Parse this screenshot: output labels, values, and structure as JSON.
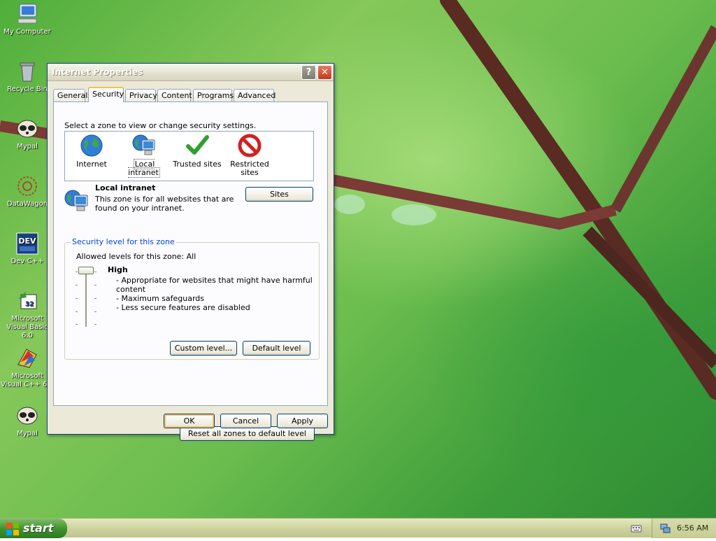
{
  "desktop": {
    "icons": [
      {
        "label": "My Computer"
      },
      {
        "label": "Recycle Bin"
      },
      {
        "label": "Mypal"
      },
      {
        "label": "DataWagon"
      },
      {
        "label": "Dev-C++"
      },
      {
        "label": "Microsoft Visual Basic 6.0"
      },
      {
        "label": "Microsoft Visual C++ 6.0"
      },
      {
        "label": "Mypal"
      }
    ]
  },
  "window": {
    "title": "Internet Properties",
    "help_btn": "?",
    "close_btn": "✕",
    "tabs": [
      "General",
      "Security",
      "Privacy",
      "Content",
      "Programs",
      "Advanced"
    ],
    "active_tab": "Security",
    "instruction": "Select a zone to view or change security settings.",
    "zones": [
      {
        "label": "Internet",
        "icon": "globe-icon"
      },
      {
        "label": "Local intranet",
        "icon": "intranet-icon",
        "selected": true
      },
      {
        "label": "Trusted sites",
        "icon": "checkmark-icon"
      },
      {
        "label": "Restricted sites",
        "icon": "restricted-icon"
      }
    ],
    "zone_info": {
      "title": "Local intranet",
      "description": "This zone is for all websites that are found on your intranet.",
      "sites_button": "Sites"
    },
    "security_level": {
      "group_title": "Security level for this zone",
      "allowed": "Allowed levels for this zone: All",
      "level": "High",
      "bullets": [
        "- Appropriate for websites that might have harmful",
        "content",
        "- Maximum safeguards",
        "- Less secure features are disabled"
      ],
      "custom_button": "Custom level...",
      "default_button": "Default level"
    },
    "reset_button": "Reset all zones to default level",
    "ok_button": "OK",
    "cancel_button": "Cancel",
    "apply_button": "Apply"
  },
  "taskbar": {
    "start_label": "start",
    "clock": "6:56 AM"
  }
}
